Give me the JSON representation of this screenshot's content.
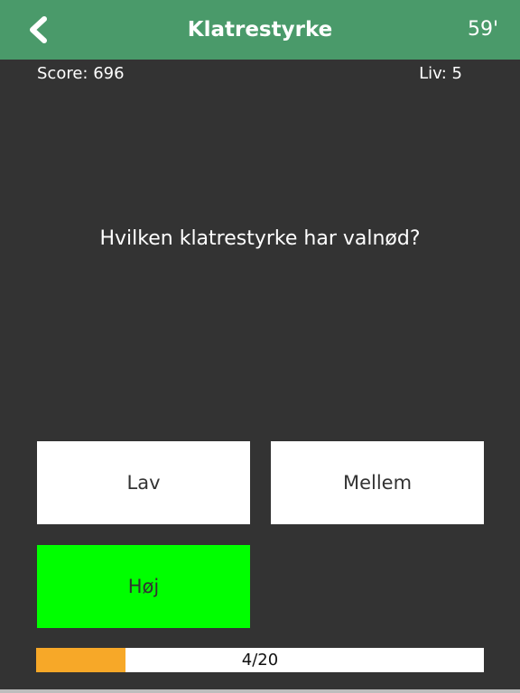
{
  "header": {
    "title": "Klatrestyrke",
    "timer": "59'",
    "back_icon": "chevron-left-icon"
  },
  "stats": {
    "score_label": "Score: 696",
    "lives_label": "Liv: 5"
  },
  "question": {
    "text": "Hvilken klatrestyrke har valnød?"
  },
  "answers": [
    {
      "label": "Lav",
      "state": "default"
    },
    {
      "label": "Mellem",
      "state": "default"
    },
    {
      "label": "Høj",
      "state": "correct"
    }
  ],
  "progress": {
    "current": 4,
    "total": 20,
    "label": "4/20",
    "fraction": 0.2
  },
  "colors": {
    "header_bg": "#4a9a6a",
    "background": "#333333",
    "correct_answer": "#00ff00",
    "progress_fill": "#f7a828"
  }
}
